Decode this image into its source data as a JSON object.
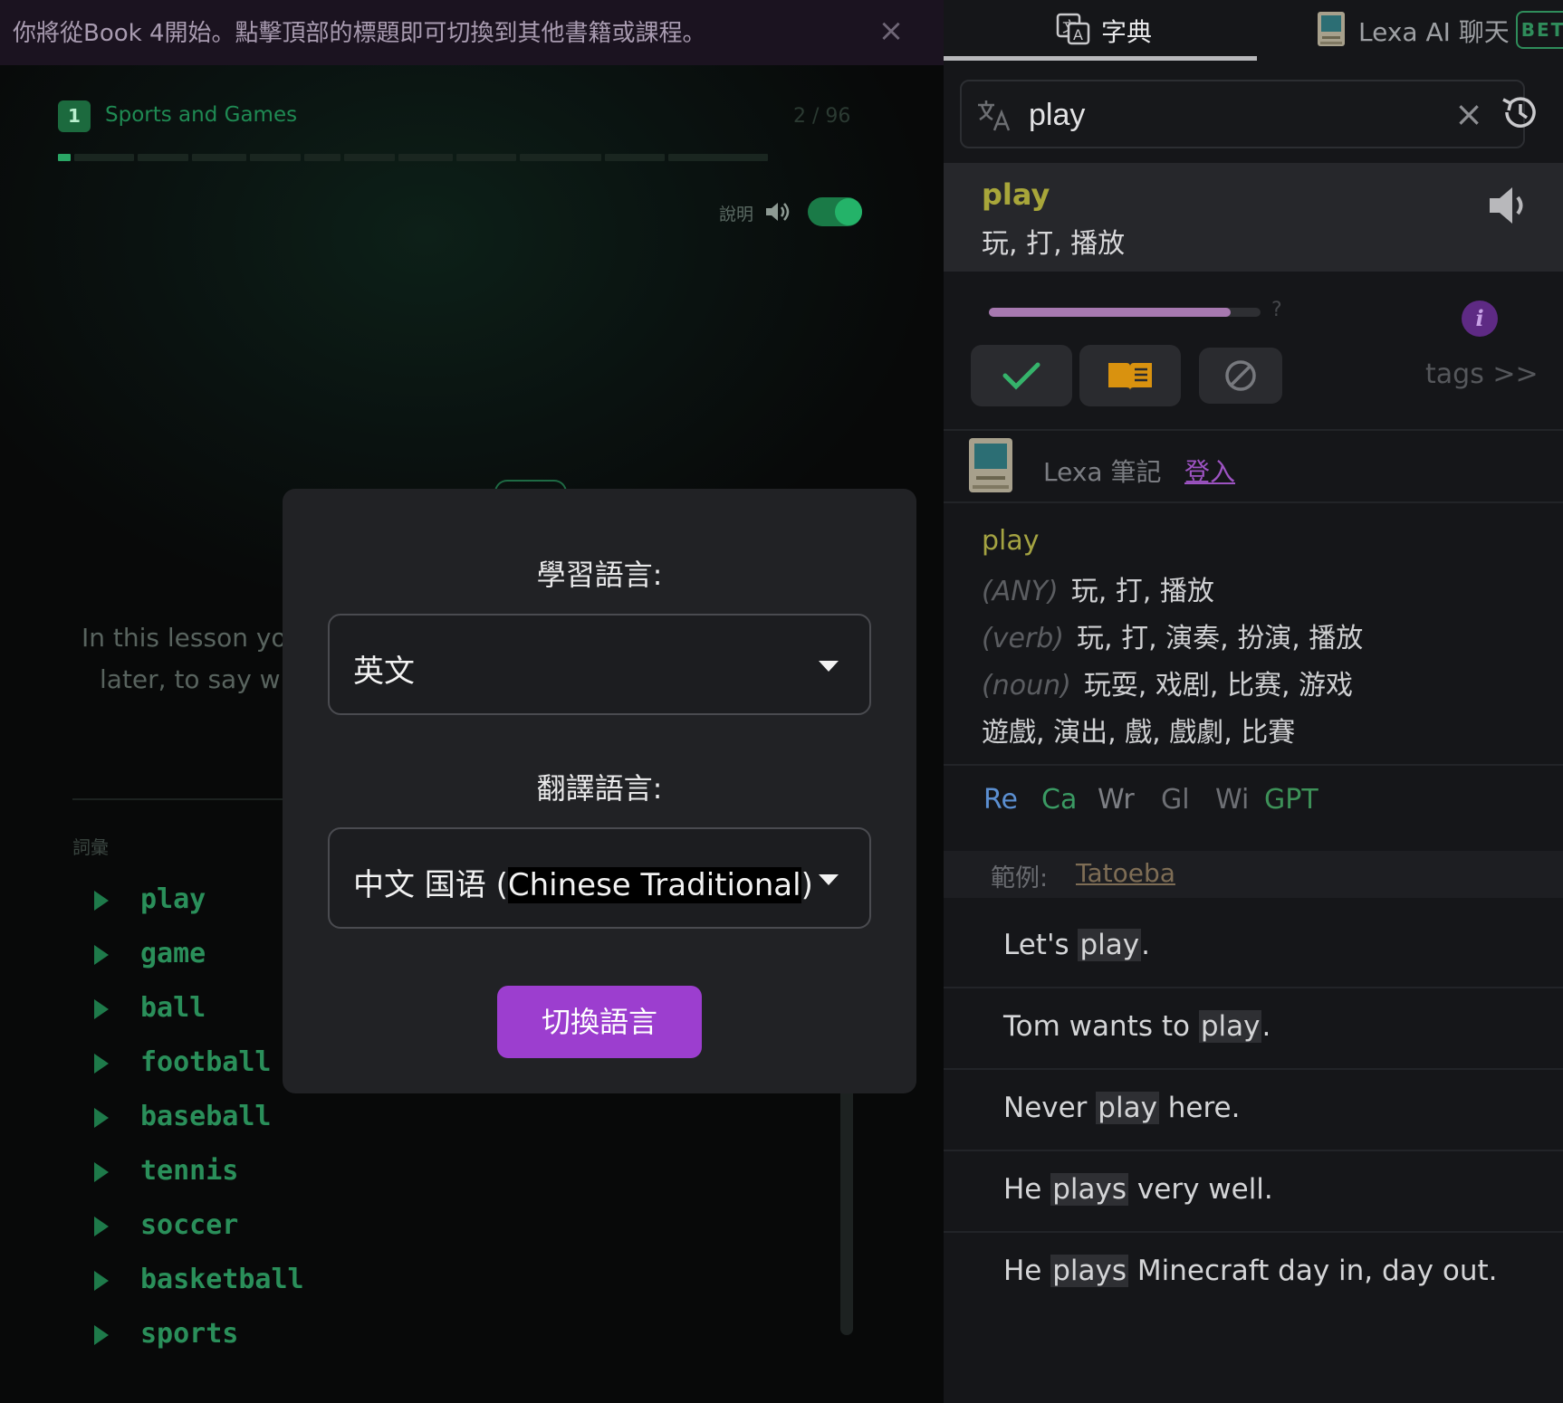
{
  "banner": {
    "text": "你將從Book 4開始。點擊頂部的標題即可切換到其他書籍或課程。",
    "close": "×"
  },
  "lesson": {
    "number": "1",
    "title": "Sports and Games",
    "progress": "2 / 96",
    "progress_fraction": 0.02,
    "explain_label": "說明",
    "explain_on": true,
    "body_line1": "In this lesson you",
    "body_line2": "later, to say wha",
    "vocab_label": "詞彙",
    "vocab": [
      "play",
      "game",
      "ball",
      "football",
      "baseball",
      "tennis",
      "soccer",
      "basketball",
      "sports"
    ]
  },
  "modal": {
    "study_label": "學習語言:",
    "study_value": "英文",
    "translate_label": "翻譯語言:",
    "translate_value_prefix": "中文 国语 (",
    "translate_value_highlight": "Chinese Traditional",
    "translate_value_suffix": ")",
    "switch_button": "切換語言"
  },
  "right": {
    "tab_dictionary": "字典",
    "tab_chat": "Lexa AI 聊天",
    "beta": "BETA",
    "search_value": "play",
    "clear": "×",
    "entry_word": "play",
    "entry_translation": "玩, 打, 播放",
    "level_fraction": 0.89,
    "level_question": "?",
    "info": "i",
    "tags": "tags >>",
    "notes_label": "Lexa 筆記",
    "login": "登入",
    "definitions": {
      "word": "play",
      "rows": [
        {
          "pos": "(ANY)",
          "text": "玩, 打, 播放"
        },
        {
          "pos": "(verb)",
          "text": "玩, 打, 演奏, 扮演, 播放"
        },
        {
          "pos": "(noun)",
          "text": "玩耍, 戏剧, 比赛, 游戏"
        },
        {
          "pos": "",
          "text": "遊戲, 演出, 戲, 戲劇, 比賽"
        }
      ]
    },
    "sources": [
      {
        "label": "Re",
        "color": "#5b8fd1"
      },
      {
        "label": "Ca",
        "color": "#3a9a63"
      },
      {
        "label": "Wr",
        "color": "#7d7f84"
      },
      {
        "label": "Gl",
        "color": "#6d6f74"
      },
      {
        "label": "Wi",
        "color": "#6d6f74"
      },
      {
        "label": "GPT",
        "color": "#3d9158"
      }
    ],
    "examples_label": "範例:",
    "examples_source": "Tatoeba",
    "examples": [
      {
        "pre": "Let's ",
        "hl": "play",
        "post": "."
      },
      {
        "pre": "Tom wants to ",
        "hl": "play",
        "post": "."
      },
      {
        "pre": "Never ",
        "hl": "play",
        "post": " here."
      },
      {
        "pre": "He ",
        "hl": "plays",
        "post": " very well."
      },
      {
        "pre": "He ",
        "hl": "plays",
        "post": " Minecraft day in, day out."
      }
    ]
  }
}
